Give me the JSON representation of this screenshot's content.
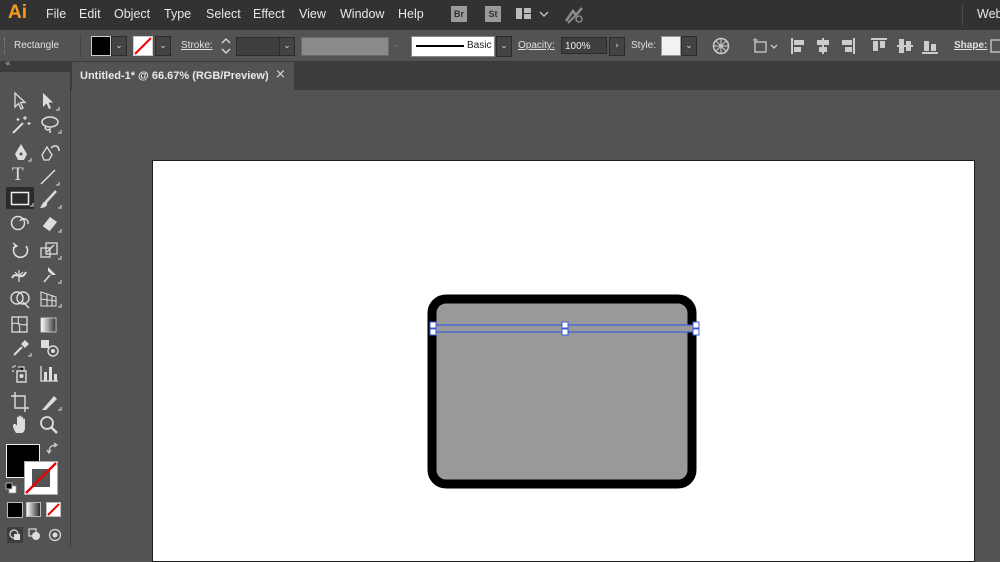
{
  "app": {
    "logo": "Ai"
  },
  "menu": {
    "items": [
      "File",
      "Edit",
      "Object",
      "Type",
      "Select",
      "Effect",
      "View",
      "Window",
      "Help"
    ],
    "bridge_label": "Br",
    "stock_label": "St",
    "workspace_label": "Web"
  },
  "control_bar": {
    "tool_name": "Rectangle",
    "stroke_label": "Stroke:",
    "brush_label": "Basic",
    "opacity_label": "Opacity:",
    "opacity_value": "100%",
    "style_label": "Style:",
    "shape_label": "Shape:"
  },
  "document": {
    "tab_title": "Untitled-1* @ 66.67% (RGB/Preview)",
    "close_glyph": "×"
  },
  "colors": {
    "accent": "#f49a21",
    "selection": "#3b5bdb",
    "shape_fill": "#999999",
    "shape_stroke": "#000000"
  }
}
